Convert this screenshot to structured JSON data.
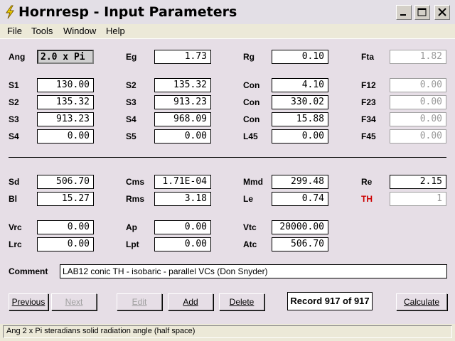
{
  "window": {
    "title": "Hornresp - Input Parameters"
  },
  "menu": [
    "File",
    "Tools",
    "Window",
    "Help"
  ],
  "fields": [
    {
      "id": "ang",
      "label": "Ang",
      "value": "2.0 x Pi",
      "state": "selected"
    },
    {
      "id": "eg",
      "label": "Eg",
      "value": "1.73"
    },
    {
      "id": "rg",
      "label": "Rg",
      "value": "0.10"
    },
    {
      "id": "fta",
      "label": "Fta",
      "value": "1.82",
      "state": "disabled"
    },
    {
      "id": "s1",
      "label": "S1",
      "value": "130.00"
    },
    {
      "id": "s2b",
      "label": "S2",
      "value": "135.32"
    },
    {
      "id": "con1",
      "label": "Con",
      "value": "4.10"
    },
    {
      "id": "f12",
      "label": "F12",
      "value": "0.00",
      "state": "disabled"
    },
    {
      "id": "s2",
      "label": "S2",
      "value": "135.32"
    },
    {
      "id": "s3b",
      "label": "S3",
      "value": "913.23"
    },
    {
      "id": "con2",
      "label": "Con",
      "value": "330.02"
    },
    {
      "id": "f23",
      "label": "F23",
      "value": "0.00",
      "state": "disabled"
    },
    {
      "id": "s3",
      "label": "S3",
      "value": "913.23"
    },
    {
      "id": "s4b",
      "label": "S4",
      "value": "968.09"
    },
    {
      "id": "con3",
      "label": "Con",
      "value": "15.88"
    },
    {
      "id": "f34",
      "label": "F34",
      "value": "0.00",
      "state": "disabled"
    },
    {
      "id": "s4",
      "label": "S4",
      "value": "0.00"
    },
    {
      "id": "s5",
      "label": "S5",
      "value": "0.00"
    },
    {
      "id": "l45",
      "label": "L45",
      "value": "0.00"
    },
    {
      "id": "f45",
      "label": "F45",
      "value": "0.00",
      "state": "disabled"
    },
    {
      "id": "sd",
      "label": "Sd",
      "value": "506.70"
    },
    {
      "id": "cms",
      "label": "Cms",
      "value": "1.71E-04"
    },
    {
      "id": "mmd",
      "label": "Mmd",
      "value": "299.48"
    },
    {
      "id": "re",
      "label": "Re",
      "value": "2.15"
    },
    {
      "id": "bl",
      "label": "Bl",
      "value": "15.27"
    },
    {
      "id": "rms",
      "label": "Rms",
      "value": "3.18"
    },
    {
      "id": "le",
      "label": "Le",
      "value": "0.74"
    },
    {
      "id": "th",
      "label": "TH",
      "value": "1",
      "state": "disabled",
      "label_color": "#cc0000"
    },
    {
      "id": "vrc",
      "label": "Vrc",
      "value": "0.00"
    },
    {
      "id": "ap",
      "label": "Ap",
      "value": "0.00"
    },
    {
      "id": "vtc",
      "label": "Vtc",
      "value": "20000.00"
    },
    {
      "id": "lrc",
      "label": "Lrc",
      "value": "0.00"
    },
    {
      "id": "lpt",
      "label": "Lpt",
      "value": "0.00"
    },
    {
      "id": "atc",
      "label": "Atc",
      "value": "506.70"
    }
  ],
  "comment": {
    "label": "Comment",
    "value": "LAB12 conic TH - isobaric - parallel VCs (Don Snyder)"
  },
  "buttons": {
    "previous": "Previous",
    "next": "Next",
    "edit": "Edit",
    "add": "Add",
    "delete": "Delete",
    "calculate": "Calculate"
  },
  "record": "Record 917 of 917",
  "status": "Ang   2 x Pi steradians solid radiation angle  (half space)",
  "colors": {
    "client_bg": "#E6DEE6",
    "disabled_text": "#9a9a9a",
    "th_label": "#cc0000"
  }
}
